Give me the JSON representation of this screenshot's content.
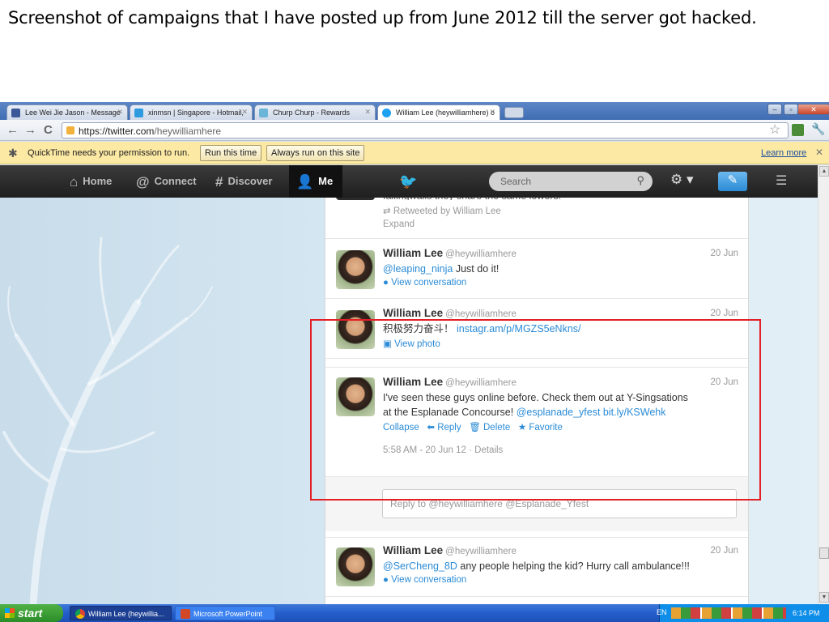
{
  "caption": "Screenshot of campaigns that I have posted up from June 2012 till the server got hacked.",
  "browser": {
    "tabs": [
      {
        "title": "Lee Wei Jie Jason - Message",
        "icon": "facebook-icon",
        "color": "#3b5998"
      },
      {
        "title": "xinmsn | Singapore - Hotmail,",
        "icon": "msn-icon",
        "color": "#2e9be0"
      },
      {
        "title": "Churp Churp - Rewards",
        "icon": "churp-icon",
        "color": "#6bb5d8"
      },
      {
        "title": "William Lee (heywilliamhere) o",
        "icon": "twitter-icon",
        "color": "#1da1f2"
      }
    ],
    "url_host": "https://twitter.com",
    "url_path": "/heywilliamhere",
    "infobar": {
      "message": "QuickTime needs your permission to run.",
      "run_once": "Run this time",
      "always_run": "Always run on this site",
      "learn_more": "Learn more"
    }
  },
  "twitter": {
    "nav": [
      {
        "label": "Home",
        "icon": "home-icon",
        "glyph": "⌂"
      },
      {
        "label": "Connect",
        "icon": "at-icon",
        "glyph": "@"
      },
      {
        "label": "Discover",
        "icon": "hash-icon",
        "glyph": "#"
      },
      {
        "label": "Me",
        "icon": "person-icon",
        "glyph": "☺"
      }
    ],
    "search_placeholder": "Search",
    "partial_tweet": {
      "text": "fallingwalls they share the same lowers!",
      "retweeted": "Retweeted by William Lee",
      "expand": "Expand"
    },
    "tweets": [
      {
        "name": "William Lee",
        "handle": "@heywilliamhere",
        "date": "20 Jun",
        "mention": "@leaping_ninja",
        "text": " Just do it!",
        "action": "View conversation"
      },
      {
        "name": "William Lee",
        "handle": "@heywilliamhere",
        "date": "20 Jun",
        "text": "积极努力奋斗！ ",
        "link": "instagr.am/p/MGZS5eNkns/",
        "action": "View photo"
      },
      {
        "name": "William Lee",
        "handle": "@heywilliamhere",
        "date": "20 Jun",
        "text_line1": "I've seen these guys online before. Check them out at Y-Singsations",
        "text_line2": "at the Esplanade Concourse! ",
        "mention": "@esplanade_yfest",
        "link": "bit.ly/KSWehk",
        "actions": {
          "collapse": "Collapse",
          "reply": "Reply",
          "delete": "Delete",
          "favorite": "Favorite"
        },
        "timestamp": "5:58 AM - 20 Jun 12 · Details",
        "reply_placeholder": "Reply to @heywilliamhere @Esplanade_Yfest"
      },
      {
        "name": "William Lee",
        "handle": "@heywilliamhere",
        "date": "20 Jun",
        "mention": "@SerCheng_8D",
        "text": " any people helping the kid? Hurry call ambulance!!!",
        "action": "View conversation"
      }
    ]
  },
  "taskbar": {
    "start": "start",
    "tasks": [
      "William Lee (heywillia...",
      "Microsoft PowerPoint"
    ],
    "lang": "EN",
    "clock": "6:14 PM"
  }
}
